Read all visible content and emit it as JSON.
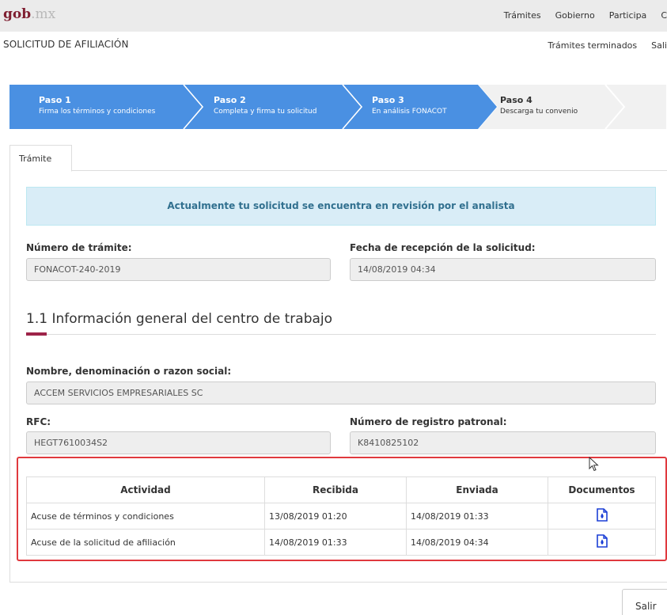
{
  "header": {
    "brand_main": "gob",
    "brand_tld": ".mx",
    "nav": [
      "Trámites",
      "Gobierno",
      "Participa",
      "C"
    ]
  },
  "subheader": {
    "title": "SOLICITUD DE AFILIACIÓN",
    "links": [
      "Trámites terminados",
      "Sali"
    ]
  },
  "steps": [
    {
      "title": "Paso 1",
      "desc": "Firma los términos y condiciones",
      "state": "done"
    },
    {
      "title": "Paso 2",
      "desc": "Completa y firma tu solicitud",
      "state": "done"
    },
    {
      "title": "Paso 3",
      "desc": "En análisis FONACOT",
      "state": "done"
    },
    {
      "title": "Paso 4",
      "desc": "Descarga tu convenio",
      "state": "current"
    }
  ],
  "colors": {
    "step_done": "#4a90e2",
    "step_pending": "#f1f1f1",
    "alert_bg": "#d9edf7",
    "accent": "#9d2449",
    "highlight": "#e0393e"
  },
  "tabs": [
    "Trámite"
  ],
  "alert": "Actualmente tu solicitud se encuentra en revisión por el analista",
  "fields": {
    "numero_tramite": {
      "label": "Número de trámite:",
      "value": "FONACOT-240-2019"
    },
    "fecha_recepcion": {
      "label": "Fecha de recepción de la solicitud:",
      "value": "14/08/2019 04:34"
    },
    "razon_social": {
      "label": "Nombre, denominación o razon social:",
      "value": "ACCEM SERVICIOS EMPRESARIALES SC"
    },
    "rfc": {
      "label": "RFC:",
      "value": "HEGT7610034S2"
    },
    "registro_patronal": {
      "label": "Número de registro patronal:",
      "value": "K8410825102"
    }
  },
  "section": {
    "title": "1.1 Información general del centro de trabajo"
  },
  "table": {
    "headers": [
      "Actividad",
      "Recibida",
      "Enviada",
      "Documentos"
    ],
    "rows": [
      {
        "actividad": "Acuse de términos y condiciones",
        "recibida": "13/08/2019 01:20",
        "enviada": "14/08/2019 01:33",
        "documento_icon": "pdf-icon"
      },
      {
        "actividad": "Acuse de la solicitud de afiliación",
        "recibida": "14/08/2019 01:33",
        "enviada": "14/08/2019 04:34",
        "documento_icon": "pdf-icon"
      }
    ]
  },
  "footer": {
    "salir_label": "Salir"
  }
}
